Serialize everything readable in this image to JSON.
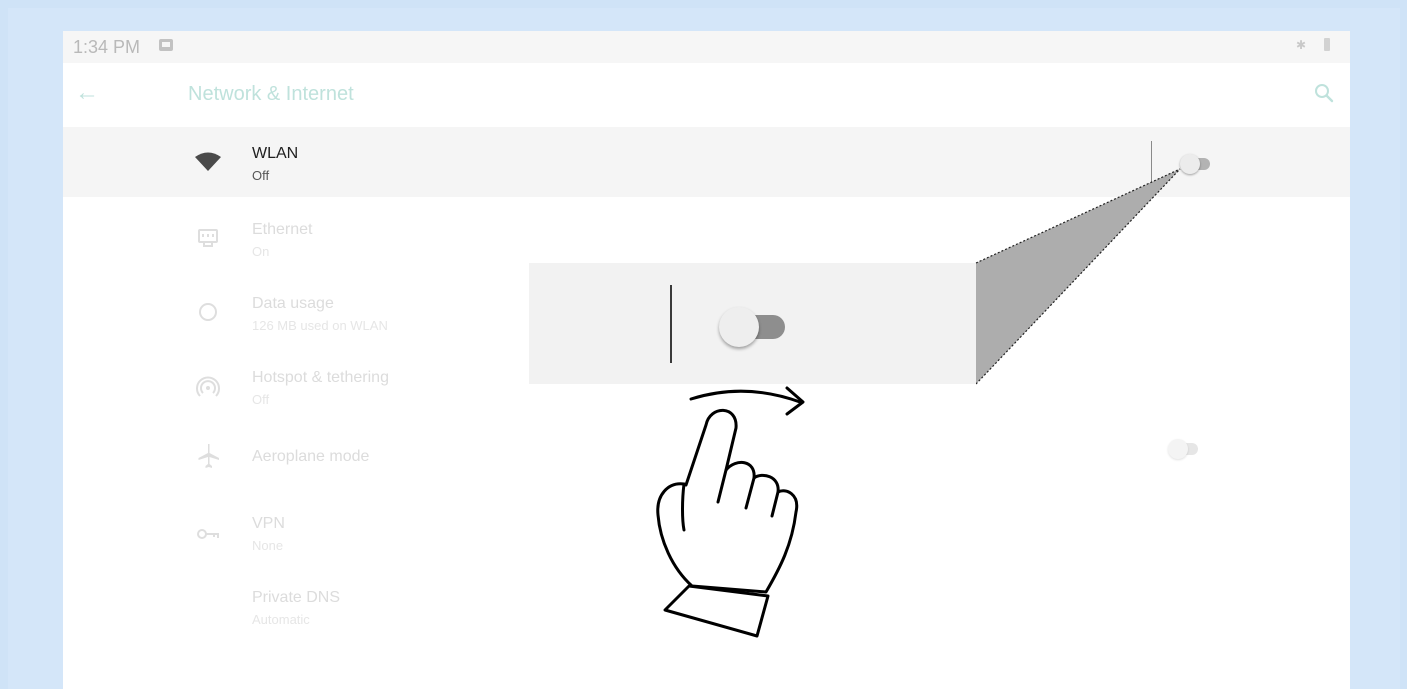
{
  "statusbar": {
    "time": "1:34 PM",
    "image_icon": "image-icon",
    "bluetooth_icon": "bluetooth-icon",
    "battery_icon": "battery-icon"
  },
  "appbar": {
    "back_icon": "back-arrow-icon",
    "title": "Network & Internet",
    "search_icon": "search-icon"
  },
  "settings": [
    {
      "icon": "wifi-icon",
      "title": "WLAN",
      "subtitle": "Off",
      "toggle": false
    },
    {
      "icon": "ethernet-icon",
      "title": "Ethernet",
      "subtitle": "On"
    },
    {
      "icon": "data-usage-icon",
      "title": "Data usage",
      "subtitle": "126 MB used on WLAN"
    },
    {
      "icon": "hotspot-icon",
      "title": "Hotspot & tethering",
      "subtitle": "Off"
    },
    {
      "icon": "airplane-icon",
      "title": "Aeroplane mode",
      "subtitle": "",
      "toggle": false
    },
    {
      "icon": "vpn-key-icon",
      "title": "VPN",
      "subtitle": "None"
    },
    {
      "icon": "",
      "title": "Private DNS",
      "subtitle": "Automatic"
    }
  ],
  "overlay": {
    "zoom_toggle_state": "off",
    "gesture_icon": "swipe-right-hand-icon",
    "arrow_icon": "curved-arrow-right-icon"
  },
  "colors": {
    "accent": "#bfe2dc",
    "frame": "#cfe3f7",
    "active_row": "#f5f5f5"
  }
}
